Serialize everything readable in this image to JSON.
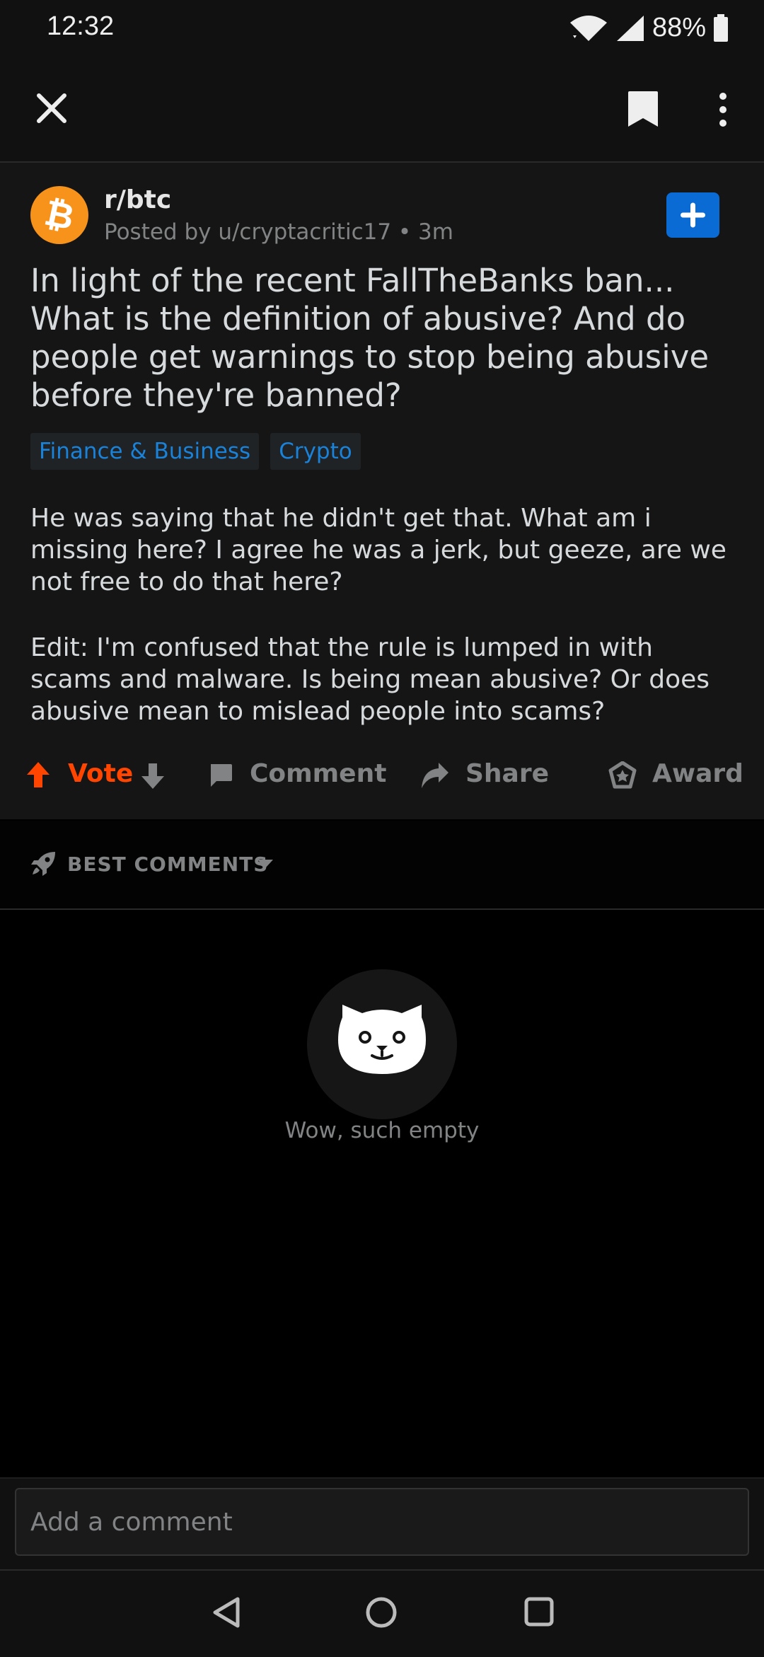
{
  "status_bar": {
    "time": "12:32",
    "battery": "88%"
  },
  "post": {
    "subreddit": "r/btc",
    "meta": "Posted by u/cryptacritic17 • 3m",
    "title": "In light of the recent FallTheBanks ban... What is the definition of abusive? And do people get warnings to stop being abusive before they're banned?",
    "flairs": [
      "Finance & Business",
      "Crypto"
    ],
    "body": [
      "He was saying that he didn't get that. What am i missing here? I agree he was a jerk, but geeze, are we not free to do that here?",
      "Edit: I'm confused that the rule is lumped in with scams and malware. Is being mean abusive? Or does abusive mean to mislead people into scams?"
    ],
    "actions": {
      "vote": "Vote",
      "comment": "Comment",
      "share": "Share",
      "award": "Award"
    }
  },
  "comments": {
    "sort_label": "BEST COMMENTS",
    "empty_text": "Wow, such empty"
  },
  "composer": {
    "placeholder": "Add a comment"
  },
  "colors": {
    "accent": "#ff4500",
    "link": "#1a82d8",
    "join": "#0a6bd4",
    "btc": "#f7931a"
  }
}
